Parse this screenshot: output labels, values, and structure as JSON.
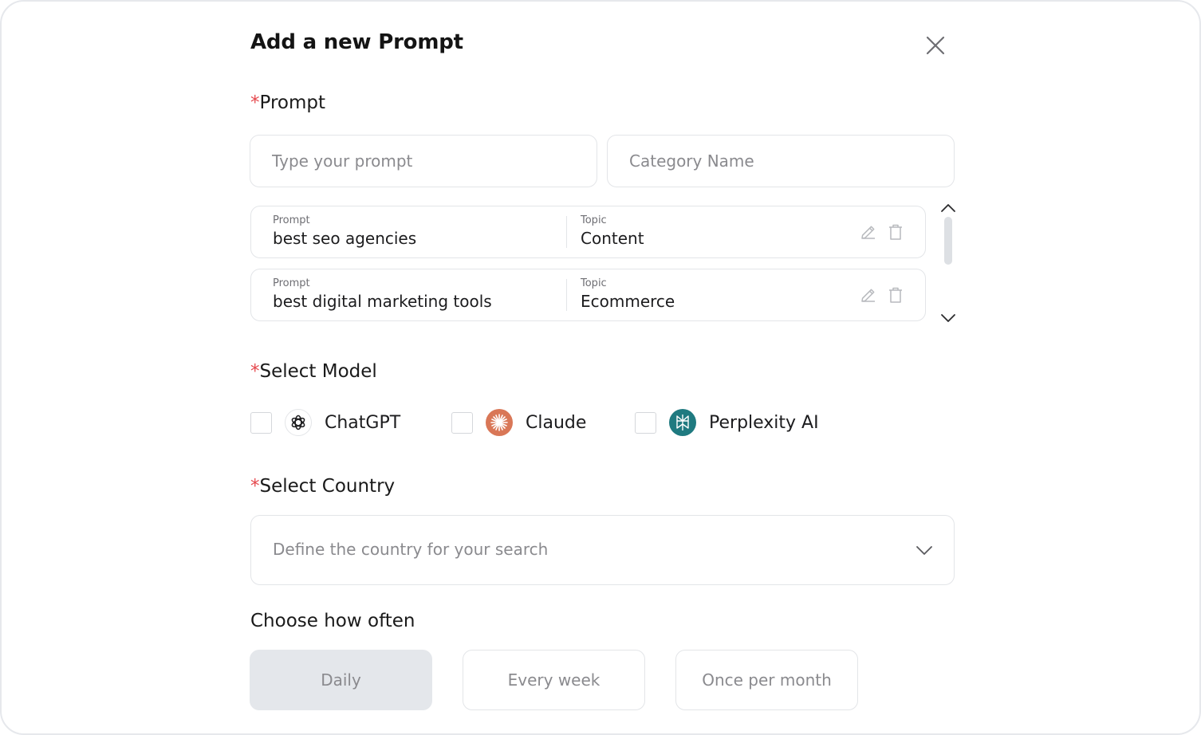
{
  "dialog": {
    "title": "Add a new Prompt"
  },
  "prompt_section": {
    "label": "Prompt",
    "required_mark": "*",
    "prompt_input": {
      "placeholder": "Type your prompt",
      "value": ""
    },
    "category_input": {
      "placeholder": "Category Name",
      "value": ""
    },
    "rows": [
      {
        "prompt_caption": "Prompt",
        "prompt": "best seo agencies",
        "topic_caption": "Topic",
        "topic": "Content"
      },
      {
        "prompt_caption": "Prompt",
        "prompt": "best digital marketing tools",
        "topic_caption": "Topic",
        "topic": "Ecommerce"
      }
    ]
  },
  "model_section": {
    "label": "Select Model",
    "required_mark": "*",
    "models": [
      {
        "name": "ChatGPT",
        "checked": false,
        "icon": "openai-logo-icon",
        "color": "#1c1c1e"
      },
      {
        "name": "Claude",
        "checked": false,
        "icon": "claude-logo-icon",
        "color": "#d97757"
      },
      {
        "name": "Perplexity AI",
        "checked": false,
        "icon": "perplexity-logo-icon",
        "color": "#1f7a80"
      }
    ]
  },
  "country_section": {
    "label": "Select Country",
    "required_mark": "*",
    "placeholder": "Define the country for your search"
  },
  "frequency_section": {
    "label": "Choose how often",
    "options": [
      {
        "label": "Daily",
        "selected": true
      },
      {
        "label": "Every week",
        "selected": false
      },
      {
        "label": "Once per month",
        "selected": false
      }
    ]
  },
  "colors": {
    "required": "#e5484d",
    "border": "#e3e5e8",
    "selected_bg": "#e4e7eb"
  }
}
